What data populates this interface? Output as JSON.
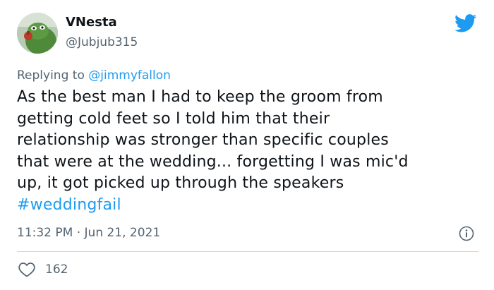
{
  "author": {
    "name": "VNesta",
    "handle": "@Jubjub315"
  },
  "reply": {
    "prefix": "Replying to ",
    "mention": "@jimmyfallon"
  },
  "tweet": {
    "lines": [
      "As the best man I had to keep the groom from",
      "getting cold feet so I told him that their",
      "relationship was stronger than specific couples",
      "that were at the wedding... forgetting I was mic'd",
      "up,  it got picked up through the speakers"
    ],
    "hashtag": "#weddingfail"
  },
  "meta": {
    "timestamp": "11:32 PM · Jun 21, 2021"
  },
  "engagement": {
    "likes": "162"
  },
  "colors": {
    "link": "#1d9bf0",
    "muted": "#536471",
    "text": "#0f1419",
    "divider": "#cfd9de"
  },
  "icons": {
    "brand": "twitter-bird-icon",
    "info": "info-icon",
    "like": "heart-icon"
  }
}
